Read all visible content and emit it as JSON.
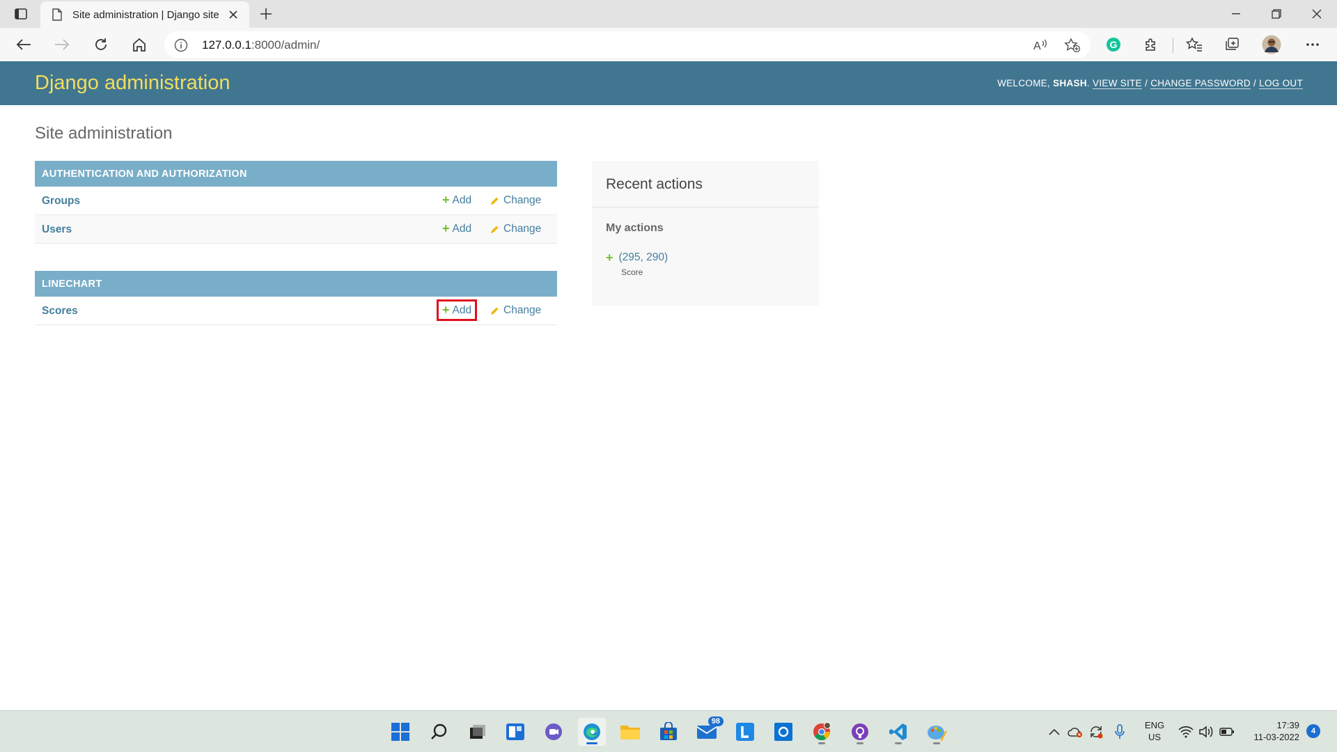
{
  "browser": {
    "tab_title": "Site administration | Django site",
    "url_host": "127.0.0.1",
    "url_rest": ":8000/admin/"
  },
  "header": {
    "branding": "Django administration",
    "welcome": "Welcome,",
    "username": "shash",
    "view_site": "View site",
    "change_password": "Change password",
    "log_out": "Log out",
    "separator": "/"
  },
  "page": {
    "title": "Site administration"
  },
  "modules": [
    {
      "caption": "Authentication and Authorization",
      "rows": [
        {
          "model": "Groups",
          "add": "Add",
          "change": "Change"
        },
        {
          "model": "Users",
          "add": "Add",
          "change": "Change"
        }
      ]
    },
    {
      "caption": "Linechart",
      "rows": [
        {
          "model": "Scores",
          "add": "Add",
          "change": "Change"
        }
      ]
    }
  ],
  "recent_actions": {
    "title": "Recent actions",
    "subtitle": "My actions",
    "entries": [
      {
        "text": "(295, 290)",
        "type": "Score"
      }
    ]
  },
  "taskbar": {
    "mail_badge": "98",
    "lang_line1": "ENG",
    "lang_line2": "US",
    "time": "17:39",
    "date": "11-03-2022",
    "notifications": "4"
  },
  "colors": {
    "header_bg": "#417690",
    "branding": "#f5dd5d",
    "module_caption": "#79aec8",
    "link": "#447e9b",
    "add_icon": "#70bf2b",
    "change_icon": "#efb80b",
    "highlight": "#e0101c"
  },
  "icons": {
    "add": "plus-icon",
    "change": "pencil-icon"
  }
}
